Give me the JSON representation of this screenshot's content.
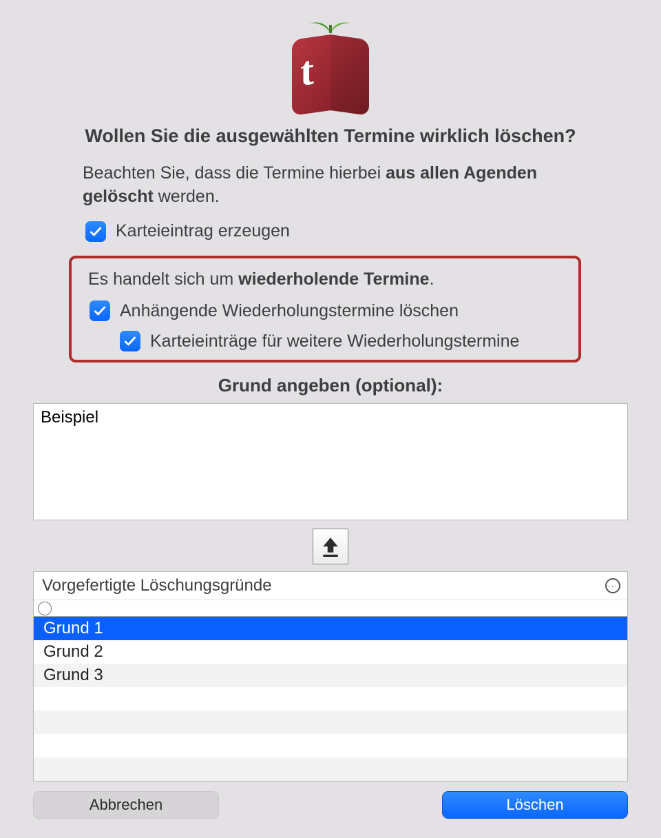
{
  "icon_letter": "t",
  "title": "Wollen Sie die ausgewählten Termine wirklich löschen?",
  "paragraph_pre": "Beachten Sie, dass die Termine hierbei ",
  "paragraph_bold": "aus allen Agenden gelöscht",
  "paragraph_post": " werden.",
  "check_create_card": {
    "label": "Karteieintrag erzeugen",
    "checked": true
  },
  "repeat_text_pre": "Es handelt sich um ",
  "repeat_text_bold": "wiederholende Termine",
  "repeat_text_post": ".",
  "check_delete_repeats": {
    "label": "Anhängende Wiederholungstermine löschen",
    "checked": true
  },
  "check_cards_repeats": {
    "label": "Karteieinträge für weitere Wiederholungstermine",
    "checked": true
  },
  "reason_heading": "Grund angeben (optional):",
  "reason_value": "Beispiel",
  "preset_heading": "Vorgefertigte Löschungsgründe",
  "preset_reasons": [
    "Grund 1",
    "Grund 2",
    "Grund 3"
  ],
  "btn_cancel": "Abbrechen",
  "btn_delete": "Löschen"
}
